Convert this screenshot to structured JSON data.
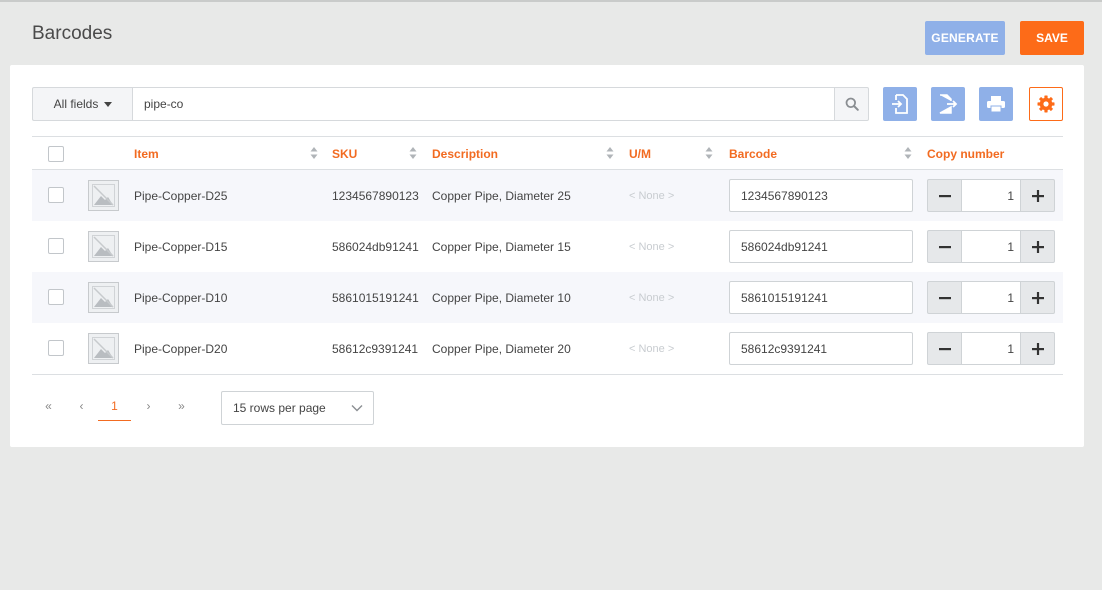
{
  "page": {
    "title": "Barcodes"
  },
  "actions": {
    "generate_label": "GENERATE",
    "save_label": "SAVE"
  },
  "search": {
    "field_label": "All fields",
    "query": "pipe-co"
  },
  "toolbar": {
    "icons": [
      "import-icon",
      "export-icon",
      "print-icon",
      "settings-icon"
    ]
  },
  "table": {
    "columns": [
      "Item",
      "SKU",
      "Description",
      "U/M",
      "Barcode",
      "Copy number"
    ],
    "rows": [
      {
        "item": "Pipe-Copper-D25",
        "sku": "1234567890123",
        "description": "Copper Pipe, Diameter 25",
        "um": "< None >",
        "barcode": "1234567890123",
        "copies": "1"
      },
      {
        "item": "Pipe-Copper-D15",
        "sku": "586024db91241",
        "description": "Copper Pipe, Diameter 15",
        "um": "< None >",
        "barcode": "586024db91241",
        "copies": "1"
      },
      {
        "item": "Pipe-Copper-D10",
        "sku": "5861015191241",
        "description": "Copper Pipe, Diameter 10",
        "um": "< None >",
        "barcode": "5861015191241",
        "copies": "1"
      },
      {
        "item": "Pipe-Copper-D20",
        "sku": "58612c9391241",
        "description": "Copper Pipe, Diameter 20",
        "um": "< None >",
        "barcode": "58612c9391241",
        "copies": "1"
      }
    ]
  },
  "pagination": {
    "first": "«",
    "prev": "‹",
    "current": "1",
    "next": "›",
    "last": "»",
    "rows_per_page": "15 rows per page"
  },
  "colors": {
    "accent": "#f26b21",
    "save": "#fd6b18",
    "primary_light": "#8fb0e8"
  }
}
